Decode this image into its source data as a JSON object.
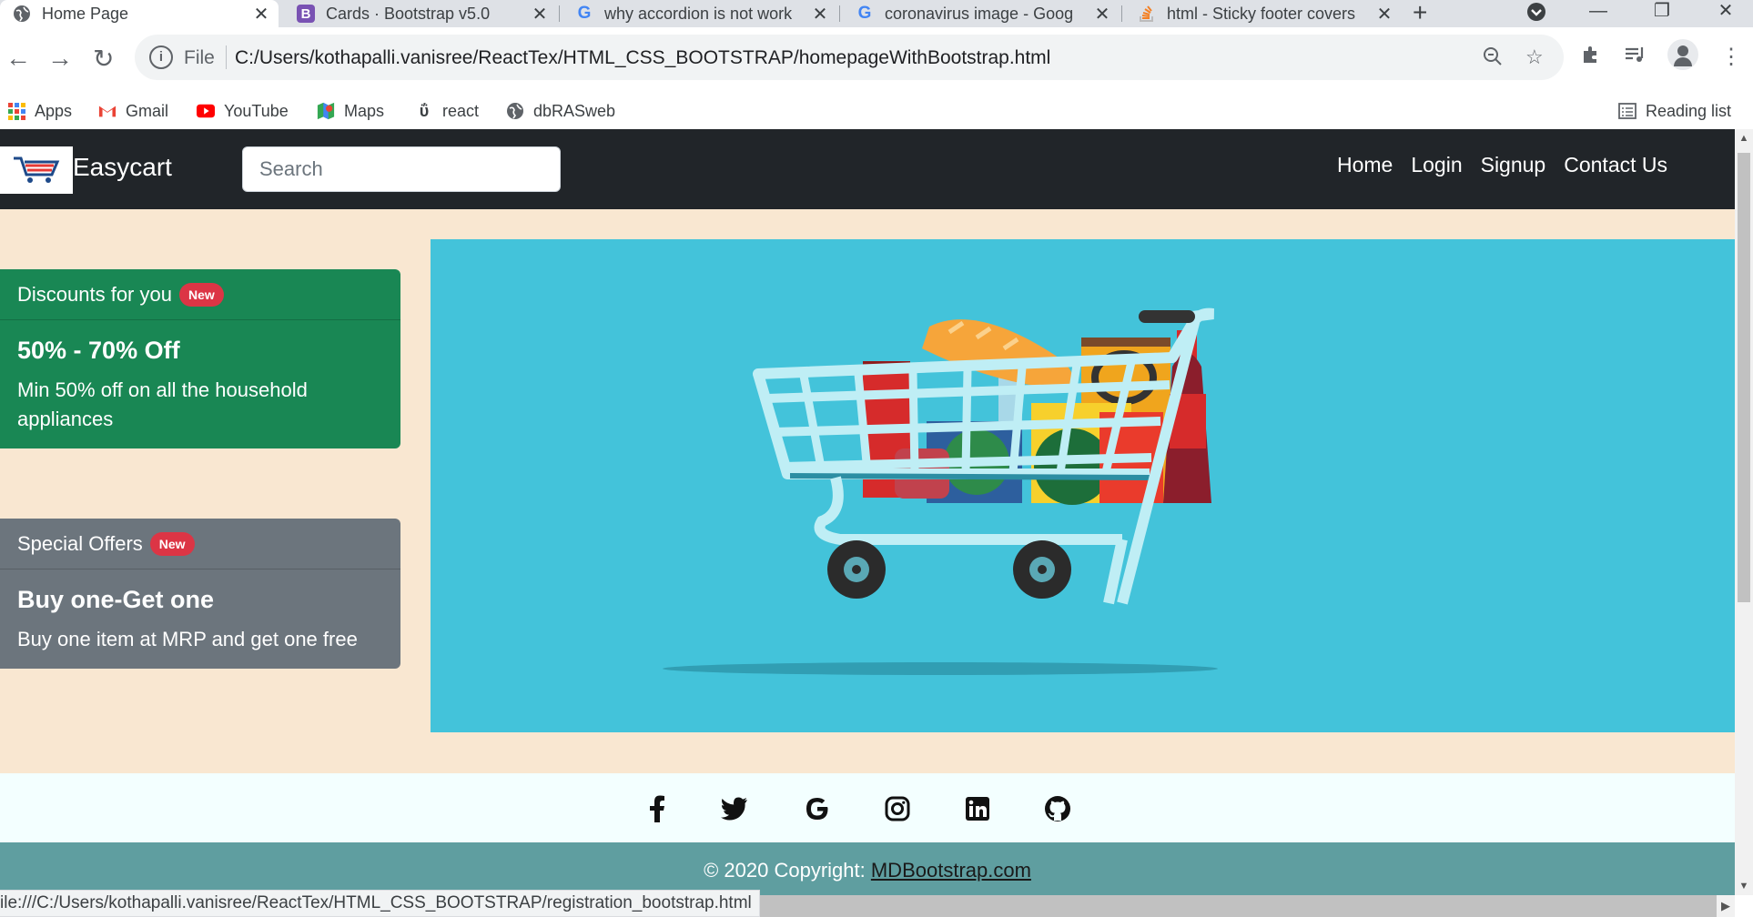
{
  "browser": {
    "tabs": [
      {
        "title": "Home Page",
        "favicon": "globe-icon",
        "active": true
      },
      {
        "title": "Cards · Bootstrap v5.0",
        "favicon": "bootstrap-icon",
        "favicon_letter": "B"
      },
      {
        "title": "why accordion is not work",
        "favicon": "google-icon",
        "favicon_letter": "G"
      },
      {
        "title": "coronavirus image - Goog",
        "favicon": "google-icon",
        "favicon_letter": "G"
      },
      {
        "title": "html - Sticky footer covers",
        "favicon": "stackoverflow-icon"
      }
    ],
    "address": {
      "scheme_label": "File",
      "url": "C:/Users/kothapalli.vanisree/ReactTex/HTML_CSS_BOOTSTRAP/homepageWithBootstrap.html"
    },
    "bookmarks": [
      {
        "label": "Apps",
        "icon": "apps-grid-icon"
      },
      {
        "label": "Gmail",
        "icon": "gmail-icon"
      },
      {
        "label": "YouTube",
        "icon": "youtube-icon"
      },
      {
        "label": "Maps",
        "icon": "maps-icon"
      },
      {
        "label": "react",
        "icon": "react-icon"
      },
      {
        "label": "dbRASweb",
        "icon": "globe-icon"
      }
    ],
    "reading_list_label": "Reading list",
    "status_url": "ile:///C:/Users/kothapalli.vanisree/ReactTex/HTML_CSS_BOOTSTRAP/registration_bootstrap.html"
  },
  "page": {
    "navbar": {
      "brand": "Easycart",
      "search_placeholder": "Search",
      "links": [
        "Home",
        "Login",
        "Signup",
        "Contact Us"
      ]
    },
    "cards": [
      {
        "header": "Discounts for you",
        "badge": "New",
        "title": "50% - 70% Off",
        "text": "Min 50% off on all the household appliances",
        "color": "#198754"
      },
      {
        "header": "Special Offers",
        "badge": "New",
        "title": "Buy one-Get one",
        "text": "Buy one item at MRP and get one free",
        "color": "#6c757d"
      }
    ],
    "hero": {
      "background": "#43c3da",
      "image": "shopping-cart-illustration"
    },
    "social_icons": [
      "facebook-icon",
      "twitter-icon",
      "google-icon",
      "instagram-icon",
      "linkedin-icon",
      "github-icon"
    ],
    "footer": {
      "copyright_prefix": "© 2020 Copyright:",
      "link_text": "MDBootstrap.com"
    },
    "colors": {
      "page_bg": "#f9e7d1",
      "navbar_bg": "#212529",
      "footer_social_bg": "#f3ffff",
      "footer_copyright_bg": "#5f9ea0"
    }
  }
}
